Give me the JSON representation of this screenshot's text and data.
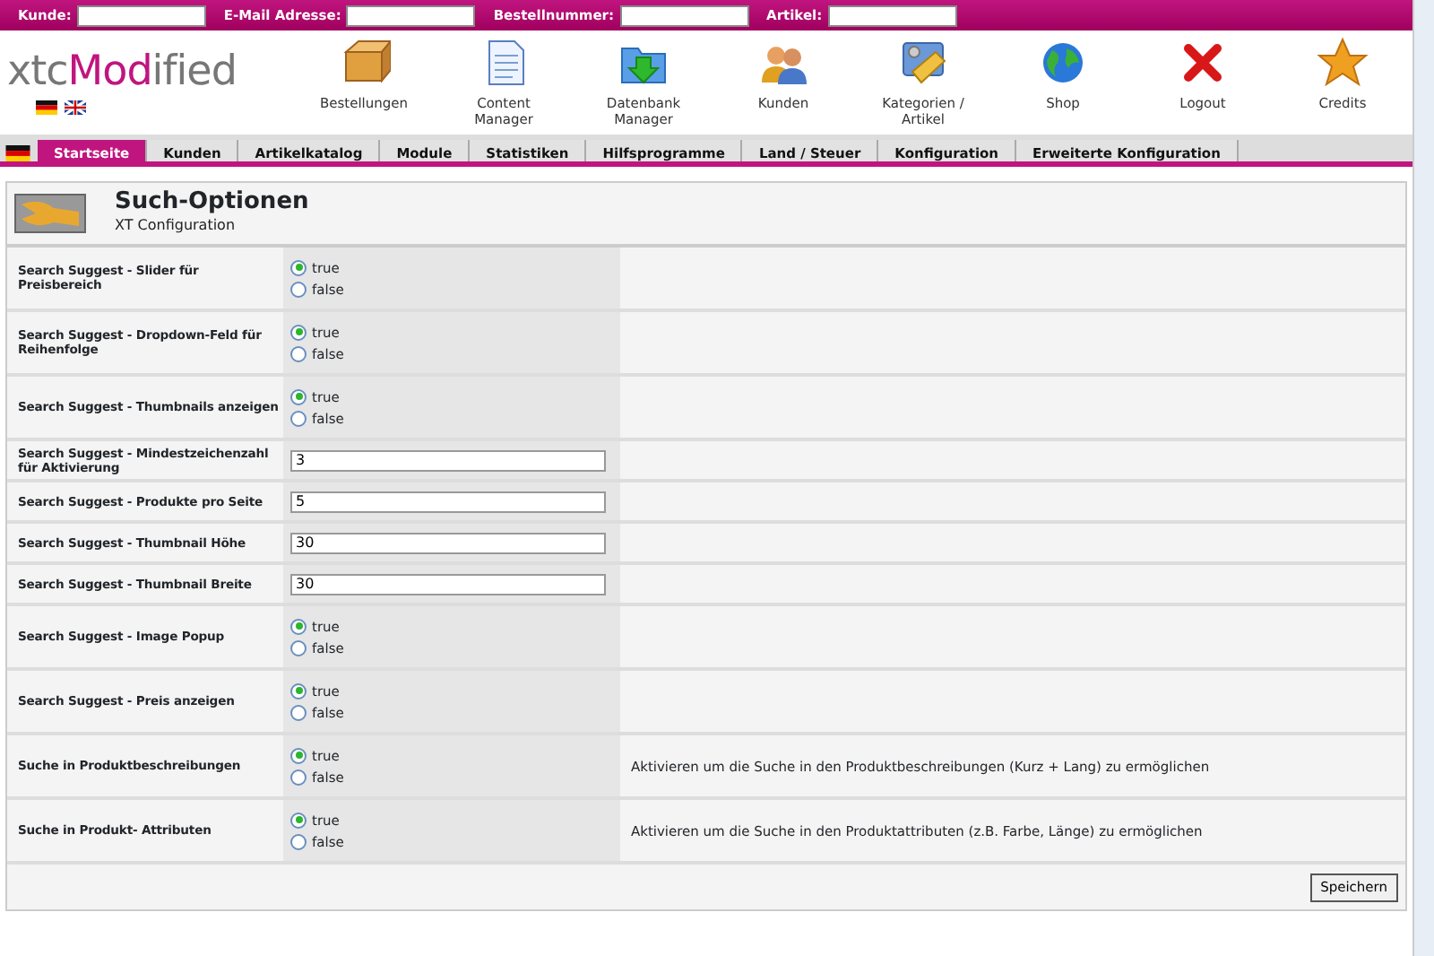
{
  "search_bar": [
    {
      "label": "Kunde:"
    },
    {
      "label": "E-Mail Adresse:"
    },
    {
      "label": "Bestellnummer:"
    },
    {
      "label": "Artikel:"
    }
  ],
  "logo": {
    "part_1": "xtc",
    "part_2": "Mod",
    "part_3": "ified"
  },
  "languages": [
    {
      "kind": "de"
    },
    {
      "kind": "en"
    }
  ],
  "toolbar": [
    {
      "label": "Bestellungen",
      "kind": "box"
    },
    {
      "label": "Content Manager",
      "kind": "document"
    },
    {
      "label": "Datenbank Manager",
      "kind": "folder"
    },
    {
      "label": "Kunden",
      "kind": "people"
    },
    {
      "label": "Kategorien / Artikel",
      "kind": "tools"
    },
    {
      "label": "Shop",
      "kind": "globe"
    },
    {
      "label": "Logout",
      "kind": "cross"
    },
    {
      "label": "Credits",
      "kind": "star"
    }
  ],
  "tabs": [
    {
      "label": "Startseite",
      "selected": true
    },
    {
      "label": "Kunden",
      "selected": false
    },
    {
      "label": "Artikelkatalog",
      "selected": false
    },
    {
      "label": "Module",
      "selected": false
    },
    {
      "label": "Statistiken",
      "selected": false
    },
    {
      "label": "Hilfsprogramme",
      "selected": false
    },
    {
      "label": "Land / Steuer",
      "selected": false
    },
    {
      "label": "Konfiguration",
      "selected": false
    },
    {
      "label": "Erweiterte Konfiguration",
      "selected": false
    }
  ],
  "page_title": "Such-Optionen",
  "page_subtitle": "XT Configuration",
  "settings": [
    {
      "label": "Search Suggest - Slider für Preisbereich",
      "kind": "radio",
      "options": [
        {
          "label": "true",
          "selected": true
        },
        {
          "label": "false",
          "selected": false
        }
      ]
    },
    {
      "label": "Search Suggest - Dropdown-Feld für Reihenfolge",
      "kind": "radio",
      "options": [
        {
          "label": "true",
          "selected": true
        },
        {
          "label": "false",
          "selected": false
        }
      ]
    },
    {
      "label": "Search Suggest - Thumbnails anzeigen",
      "kind": "radio",
      "options": [
        {
          "label": "true",
          "selected": true
        },
        {
          "label": "false",
          "selected": false
        }
      ]
    },
    {
      "label": "Search Suggest - Mindestzeichenzahl für Aktivierung",
      "kind": "text",
      "value": "3"
    },
    {
      "label": "Search Suggest - Produkte pro Seite",
      "kind": "text",
      "value": "5"
    },
    {
      "label": "Search Suggest - Thumbnail Höhe",
      "kind": "text",
      "value": "30"
    },
    {
      "label": "Search Suggest - Thumbnail Breite",
      "kind": "text",
      "value": "30"
    },
    {
      "label": "Search Suggest - Image Popup",
      "kind": "radio",
      "options": [
        {
          "label": "true",
          "selected": true
        },
        {
          "label": "false",
          "selected": false
        }
      ]
    },
    {
      "label": "Search Suggest - Preis anzeigen",
      "kind": "radio",
      "options": [
        {
          "label": "true",
          "selected": true
        },
        {
          "label": "false",
          "selected": false
        }
      ]
    },
    {
      "label": "Suche in Produktbeschreibungen",
      "kind": "radio",
      "options": [
        {
          "label": "true",
          "selected": true
        },
        {
          "label": "false",
          "selected": false
        }
      ],
      "description": "Aktivieren um die Suche in den Produktbeschreibungen (Kurz + Lang) zu ermöglichen"
    },
    {
      "label": "Suche in Produkt- Attributen",
      "kind": "radio",
      "options": [
        {
          "label": "true",
          "selected": true
        },
        {
          "label": "false",
          "selected": false
        }
      ],
      "description": "Aktivieren um die Suche in den Produktattributen (z.B. Farbe, Länge) zu ermöglichen"
    }
  ],
  "save_button": "Speichern"
}
